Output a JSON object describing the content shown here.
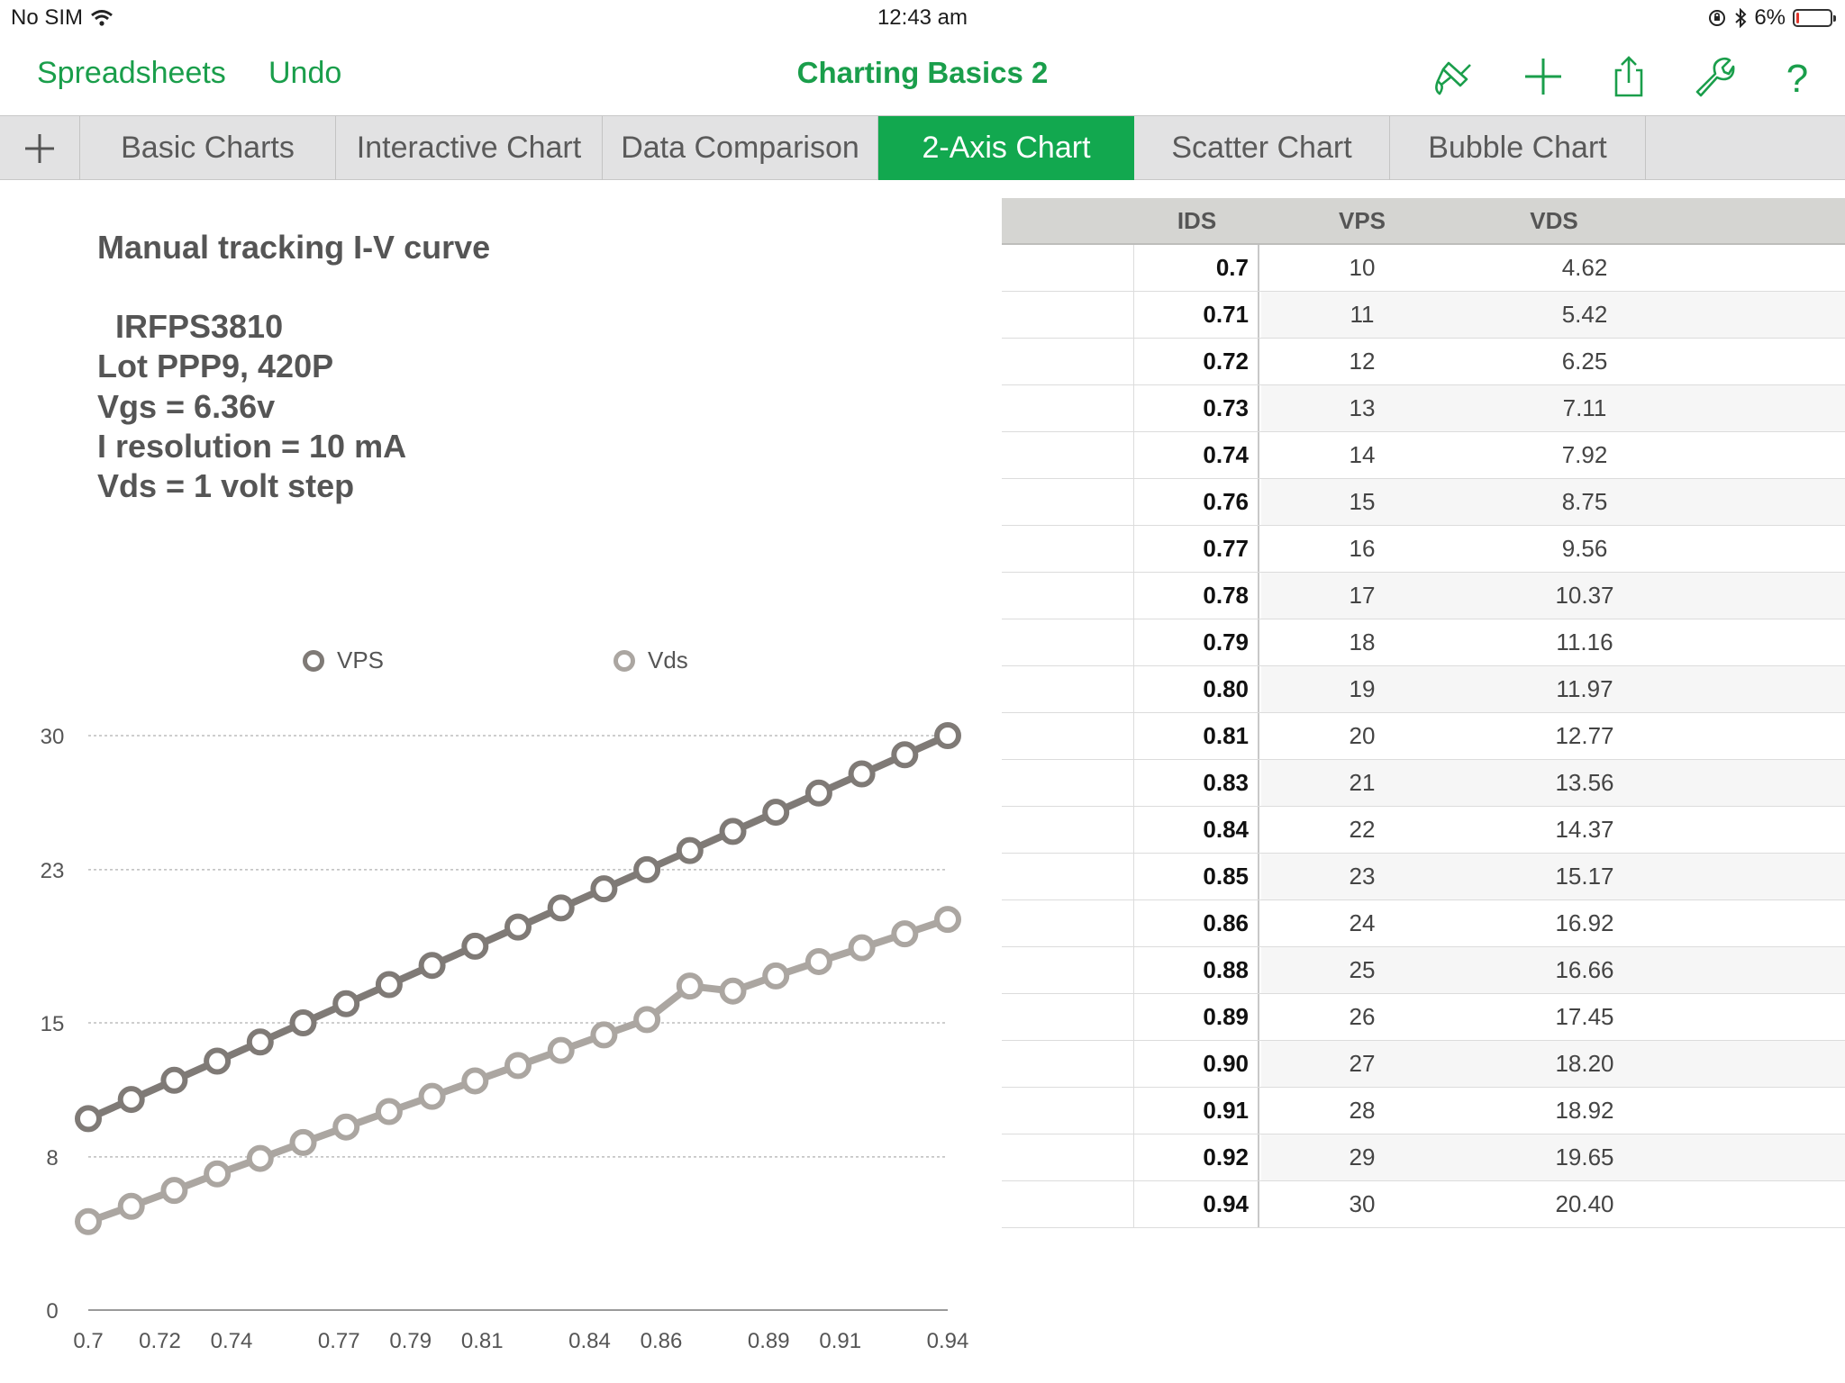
{
  "status": {
    "carrier": "No SIM",
    "time": "12:43 am",
    "battery": "6%",
    "battery_level": 0.06
  },
  "toolbar": {
    "spreadsheets": "Spreadsheets",
    "undo": "Undo",
    "title": "Charting Basics 2",
    "icons": [
      "paintbrush-icon",
      "plus-icon",
      "share-icon",
      "wrench-icon",
      "help-icon"
    ],
    "help_glyph": "?"
  },
  "tabs": [
    {
      "label": "Basic Charts",
      "active": false
    },
    {
      "label": "Interactive Chart",
      "active": false
    },
    {
      "label": "Data Comparison",
      "active": false
    },
    {
      "label": "2-Axis Chart",
      "active": true
    },
    {
      "label": "Scatter Chart",
      "active": false
    },
    {
      "label": "Bubble Chart",
      "active": false
    }
  ],
  "notes": {
    "title": "Manual tracking I-V curve",
    "part": "IRFPS3810",
    "lot": "Lot PPP9, 420P",
    "vgs": "Vgs = 6.36v",
    "resolution": "I resolution = 10 mA",
    "vds": "Vds = 1 volt step"
  },
  "colors": {
    "accent": "#12a84f",
    "link": "#1a9e4b",
    "series_vps": "#7f7a76",
    "series_vds": "#aba6a1"
  },
  "table": {
    "headers": [
      "IDS",
      "VPS",
      "VDS"
    ],
    "rows": [
      [
        "0.7",
        "10",
        "4.62"
      ],
      [
        "0.71",
        "11",
        "5.42"
      ],
      [
        "0.72",
        "12",
        "6.25"
      ],
      [
        "0.73",
        "13",
        "7.11"
      ],
      [
        "0.74",
        "14",
        "7.92"
      ],
      [
        "0.76",
        "15",
        "8.75"
      ],
      [
        "0.77",
        "16",
        "9.56"
      ],
      [
        "0.78",
        "17",
        "10.37"
      ],
      [
        "0.79",
        "18",
        "11.16"
      ],
      [
        "0.80",
        "19",
        "11.97"
      ],
      [
        "0.81",
        "20",
        "12.77"
      ],
      [
        "0.83",
        "21",
        "13.56"
      ],
      [
        "0.84",
        "22",
        "14.37"
      ],
      [
        "0.85",
        "23",
        "15.17"
      ],
      [
        "0.86",
        "24",
        "16.92"
      ],
      [
        "0.88",
        "25",
        "16.66"
      ],
      [
        "0.89",
        "26",
        "17.45"
      ],
      [
        "0.90",
        "27",
        "18.20"
      ],
      [
        "0.91",
        "28",
        "18.92"
      ],
      [
        "0.92",
        "29",
        "19.65"
      ],
      [
        "0.94",
        "30",
        "20.40"
      ]
    ]
  },
  "chart_data": {
    "type": "line",
    "x": [
      "0.7",
      "0.71",
      "0.72",
      "0.73",
      "0.74",
      "0.76",
      "0.77",
      "0.78",
      "0.79",
      "0.80",
      "0.81",
      "0.83",
      "0.84",
      "0.85",
      "0.86",
      "0.88",
      "0.89",
      "0.90",
      "0.91",
      "0.92",
      "0.94"
    ],
    "x_tick_labels": [
      "0.7",
      "0.72",
      "0.74",
      "0.77",
      "0.79",
      "0.81",
      "0.84",
      "0.86",
      "0.89",
      "0.91",
      "0.94"
    ],
    "y_ticks": [
      "0",
      "8",
      "15",
      "23",
      "30"
    ],
    "ylim": [
      0,
      30
    ],
    "legend_position": "top",
    "grid": true,
    "series": [
      {
        "name": "VPS",
        "values": [
          10,
          11,
          12,
          13,
          14,
          15,
          16,
          17,
          18,
          19,
          20,
          21,
          22,
          23,
          24,
          25,
          26,
          27,
          28,
          29,
          30
        ]
      },
      {
        "name": "Vds",
        "values": [
          4.62,
          5.42,
          6.25,
          7.11,
          7.92,
          8.75,
          9.56,
          10.37,
          11.16,
          11.97,
          12.77,
          13.56,
          14.37,
          15.17,
          16.92,
          16.66,
          17.45,
          18.2,
          18.92,
          19.65,
          20.4
        ]
      }
    ]
  }
}
